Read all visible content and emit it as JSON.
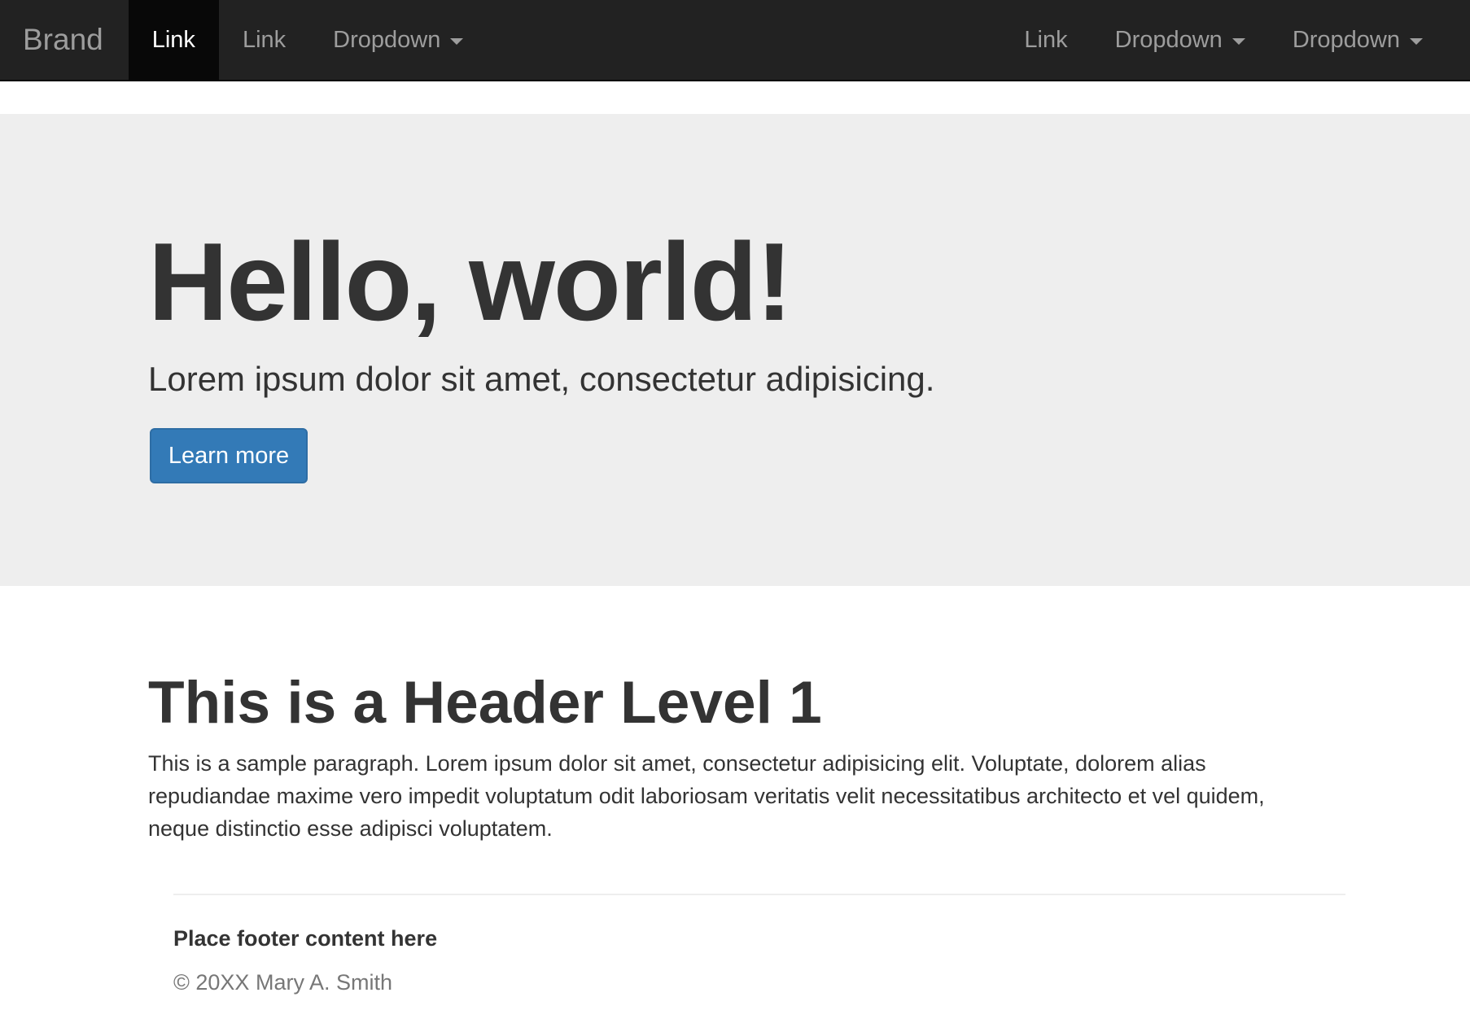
{
  "navbar": {
    "brand": "Brand",
    "left_items": [
      {
        "label": "Link",
        "active": true
      },
      {
        "label": "Link"
      },
      {
        "label": "Dropdown",
        "dropdown": true
      }
    ],
    "right_items": [
      {
        "label": "Link"
      },
      {
        "label": "Dropdown",
        "dropdown": true
      },
      {
        "label": "Dropdown",
        "dropdown": true
      }
    ],
    "caret_icon": "caret-down-icon"
  },
  "jumbotron": {
    "title": "Hello, world!",
    "lead": "Lorem ipsum dolor sit amet, consectetur adipisicing.",
    "button_label": "Learn more"
  },
  "content": {
    "heading": "This is a Header Level 1",
    "paragraph": "This is a sample paragraph. Lorem ipsum dolor sit amet, consectetur adipisicing elit. Voluptate, dolorem alias repudiandae maxime vero impedit voluptatum odit laboriosam veritatis velit necessitatibus architecto et vel quidem, neque distinctio esse adipisci voluptatem."
  },
  "footer": {
    "heading": "Place footer content here",
    "copyright": "© 20XX Mary A. Smith"
  },
  "colors": {
    "navbar_bg": "#222222",
    "navbar_active_bg": "#080808",
    "navbar_text": "#9d9d9d",
    "jumbotron_bg": "#eeeeee",
    "primary": "#337ab7",
    "text": "#333333",
    "muted": "#777777"
  }
}
